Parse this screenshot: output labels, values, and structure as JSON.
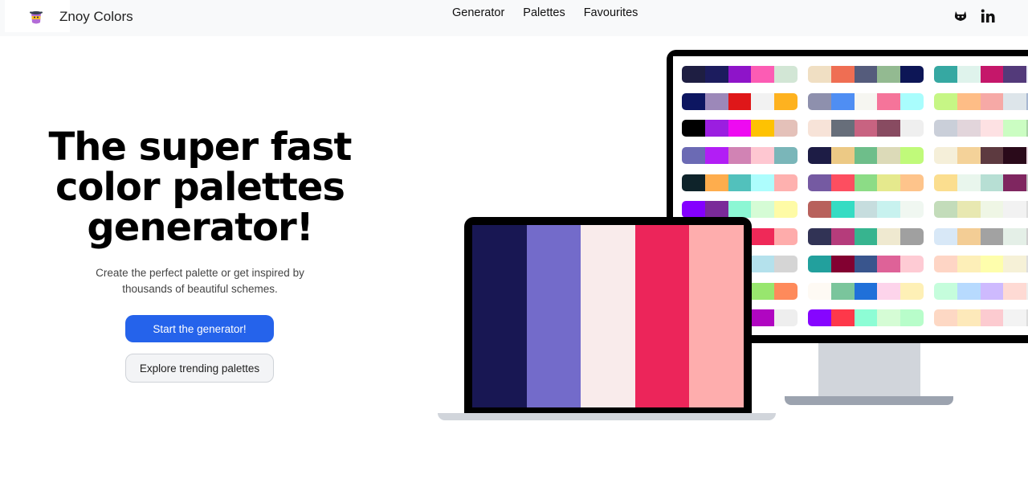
{
  "header": {
    "brand": {
      "name": "Znoy Colors",
      "logo_icon": "pot-icon"
    },
    "nav": [
      {
        "label": "Generator"
      },
      {
        "label": "Palettes"
      },
      {
        "label": "Favourites"
      }
    ],
    "social": [
      {
        "icon": "github-icon"
      },
      {
        "icon": "linkedin-icon"
      }
    ]
  },
  "hero": {
    "title_lines": [
      "The super fast",
      "color palettes",
      "generator!"
    ],
    "subtitle_lines": [
      "Create the perfect palette or get inspired by",
      "thousands of beautiful schemes."
    ],
    "primary_button": "Start the generator!",
    "secondary_button": "Explore trending palettes"
  },
  "colors": {
    "accent": "#2563eb",
    "header_bg": "#f8f9fa"
  },
  "laptop_palette": [
    "#181753",
    "#736bca",
    "#f9ebeb",
    "#ec255a",
    "#feadad"
  ],
  "monitor_palettes": [
    [
      [
        "#1e1e42",
        "#1c1c5e",
        "#8e14c9",
        "#fc5cb4",
        "#d2e6d5"
      ],
      [
        "#0d1661",
        "#9c88b9",
        "#df1719",
        "#f2f2f2",
        "#feb21f"
      ],
      [
        "#000000",
        "#9b1ee0",
        "#ee0af1",
        "#fec202",
        "#e4c1b9"
      ],
      [
        "#6b6ab4",
        "#b21ef5",
        "#d183b4",
        "#fec7d1",
        "#7ab6b9"
      ],
      [
        "#0e232a",
        "#fead4d",
        "#52c1bc",
        "#adfdfd",
        "#feb1af"
      ],
      [
        "#8400ff",
        "#7a2a99",
        "#8cf7d4",
        "#d5fcd5",
        "#fefba6"
      ],
      [
        "#e8d3a5",
        "#c22c4f",
        "#6f4a77",
        "#ef2958",
        "#feacab"
      ],
      [
        "#3b8fd3",
        "#5d6ed8",
        "#65c8d3",
        "#b4e1ec",
        "#d5d5d5"
      ],
      [
        "#e22b66",
        "#7e66d3",
        "#6bc2d8",
        "#98e66e",
        "#fe8a5b"
      ],
      [
        "#8a2b6c",
        "#a90d8d",
        "#f82ef3",
        "#b006c1",
        "#eeeeee"
      ]
    ],
    [
      [
        "#f0dfc3",
        "#ef6e53",
        "#555c7c",
        "#93ba91",
        "#0d1656"
      ],
      [
        "#8e90ad",
        "#4f8ef3",
        "#f6f6f1",
        "#f5749a",
        "#a9fdfd"
      ],
      [
        "#f7e3d8",
        "#676e7a",
        "#c86381",
        "#884b61",
        "#efefef"
      ],
      [
        "#1d1c45",
        "#ecc985",
        "#6ebe8a",
        "#dcdab8",
        "#c0fa7a"
      ],
      [
        "#755aa2",
        "#fd4e60",
        "#8cdc86",
        "#e5e98d",
        "#fec48b"
      ],
      [
        "#b8615c",
        "#35dcc3",
        "#c6ddde",
        "#c8f2ef",
        "#f0f7f1"
      ],
      [
        "#313355",
        "#b53c7b",
        "#37b48f",
        "#efe9d0",
        "#a0a0a0"
      ],
      [
        "#22a09d",
        "#820131",
        "#39558d",
        "#de6298",
        "#fecbd4"
      ],
      [
        "#fefaf4",
        "#7ac59c",
        "#2070d9",
        "#fdd4eb",
        "#fef0b6"
      ],
      [
        "#8605ff",
        "#fe384a",
        "#8dfdd5",
        "#d5fcd5",
        "#b8fdca"
      ]
    ],
    [
      [
        "#36a8a2",
        "#dff3ec",
        "#c5176a",
        "#533a7a",
        "#e9e9f6"
      ],
      [
        "#c6f685",
        "#febd86",
        "#f6a9a6",
        "#dde5ea",
        "#a7b7d1"
      ],
      [
        "#cacfd9",
        "#e2d5db",
        "#fde1e3",
        "#cbfdc2",
        "#a9d4a5"
      ],
      [
        "#f5efd9",
        "#f4d299",
        "#5d3a40",
        "#2a0a1a",
        "#e9d6e0"
      ],
      [
        "#fbde8f",
        "#e9f6ed",
        "#b7dfd4",
        "#7f2660",
        "#c4c4c4"
      ],
      [
        "#c3dcba",
        "#e8e8b1",
        "#eff6e5",
        "#f2f2f2",
        "#dddddd"
      ],
      [
        "#d8e8f7",
        "#f3cd95",
        "#a2a2a2",
        "#e4efe7",
        "#cfcfcf"
      ],
      [
        "#fed5c5",
        "#fdefb8",
        "#fefeac",
        "#f6f1d7",
        "#dddddd"
      ],
      [
        "#c5fddc",
        "#b7dafe",
        "#cebafe",
        "#fedad4",
        "#eeeeee"
      ],
      [
        "#fdd8c4",
        "#fde9ba",
        "#fccbd0",
        "#f3f3f3",
        "#dddddd"
      ]
    ]
  ]
}
